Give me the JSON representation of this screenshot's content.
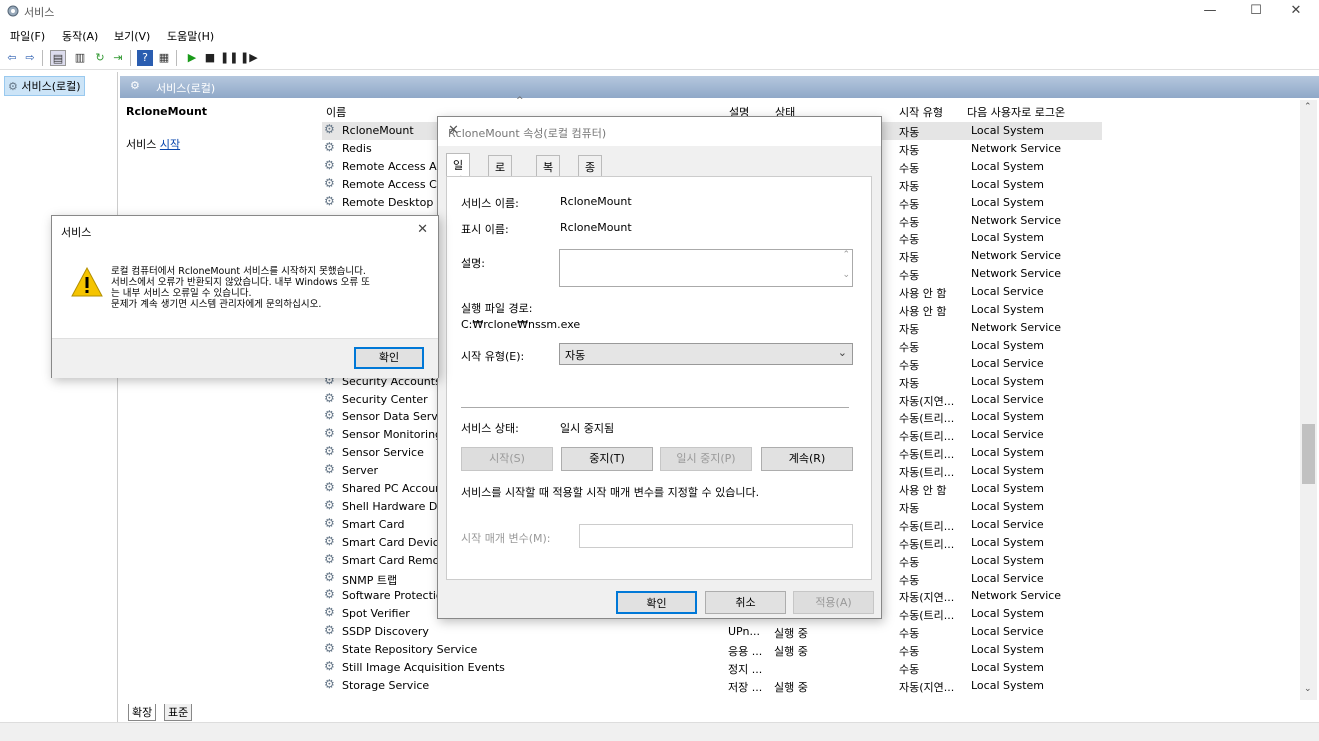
{
  "window": {
    "title": "서비스",
    "minimize": "—",
    "maximize": "☐",
    "close": "✕"
  },
  "menu": [
    "파일(F)",
    "동작(A)",
    "보기(V)",
    "도움말(H)"
  ],
  "tree": {
    "root": "서비스(로컬)"
  },
  "header": {
    "title": "서비스(로컬)"
  },
  "desc": {
    "service_name": "RcloneMount",
    "start_prefix": "서비스 ",
    "start_link": "시작"
  },
  "columns": {
    "name": "이름",
    "desc": "설명",
    "status": "상태",
    "startup": "시작 유형",
    "logon": "다음 사용자로 로그온"
  },
  "rows": [
    {
      "name": "RcloneMount",
      "desc": "",
      "status": "",
      "startup": "자동",
      "logon": "Local System"
    },
    {
      "name": "Redis",
      "desc": "",
      "status": "",
      "startup": "자동",
      "logon": "Network Service"
    },
    {
      "name": "Remote Access Aut",
      "desc": "",
      "status": "",
      "startup": "수동",
      "logon": "Local System"
    },
    {
      "name": "Remote Access Cor",
      "desc": "",
      "status": "",
      "startup": "자동",
      "logon": "Local System"
    },
    {
      "name": "Remote Desktop C",
      "desc": "",
      "status": "",
      "startup": "수동",
      "logon": "Local System"
    },
    {
      "name": "",
      "desc": "",
      "status": "",
      "startup": "수동",
      "logon": "Network Service"
    },
    {
      "name": "",
      "desc": "",
      "status": "",
      "startup": "수동",
      "logon": "Local System"
    },
    {
      "name": "",
      "desc": "",
      "status": "",
      "startup": "자동",
      "logon": "Network Service"
    },
    {
      "name": "",
      "desc": "",
      "status": "",
      "startup": "수동",
      "logon": "Network Service"
    },
    {
      "name": "",
      "desc": "",
      "status": "",
      "startup": "사용 안 함",
      "logon": "Local Service"
    },
    {
      "name": "",
      "desc": "",
      "status": "",
      "startup": "사용 안 함",
      "logon": "Local System"
    },
    {
      "name": "",
      "desc": "",
      "status": "",
      "startup": "자동",
      "logon": "Network Service"
    },
    {
      "name": "",
      "desc": "",
      "status": "",
      "startup": "수동",
      "logon": "Local System"
    },
    {
      "name": "",
      "desc": "",
      "status": "",
      "startup": "수동",
      "logon": "Local Service"
    },
    {
      "name": "Security Accounts I",
      "desc": "",
      "status": "",
      "startup": "자동",
      "logon": "Local System"
    },
    {
      "name": "Security Center",
      "desc": "",
      "status": "",
      "startup": "자동(지연...",
      "logon": "Local Service"
    },
    {
      "name": "Sensor Data Servic",
      "desc": "",
      "status": "",
      "startup": "수동(트리...",
      "logon": "Local System"
    },
    {
      "name": "Sensor Monitoring",
      "desc": "",
      "status": "",
      "startup": "수동(트리...",
      "logon": "Local Service"
    },
    {
      "name": "Sensor Service",
      "desc": "",
      "status": "",
      "startup": "수동(트리...",
      "logon": "Local System"
    },
    {
      "name": "Server",
      "desc": "",
      "status": "",
      "startup": "자동(트리...",
      "logon": "Local System"
    },
    {
      "name": "Shared PC Account",
      "desc": "",
      "status": "",
      "startup": "사용 안 함",
      "logon": "Local System"
    },
    {
      "name": "Shell Hardware Det",
      "desc": "",
      "status": "",
      "startup": "자동",
      "logon": "Local System"
    },
    {
      "name": "Smart Card",
      "desc": "",
      "status": "",
      "startup": "수동(트리...",
      "logon": "Local Service"
    },
    {
      "name": "Smart Card Device",
      "desc": "",
      "status": "",
      "startup": "수동(트리...",
      "logon": "Local System"
    },
    {
      "name": "Smart Card Remov",
      "desc": "",
      "status": "",
      "startup": "수동",
      "logon": "Local System"
    },
    {
      "name": "SNMP 트랩",
      "desc": "",
      "status": "",
      "startup": "수동",
      "logon": "Local Service"
    },
    {
      "name": "Software Protection",
      "desc": "",
      "status": "",
      "startup": "자동(지연...",
      "logon": "Network Service"
    },
    {
      "name": "Spot Verifier",
      "desc": "",
      "status": "",
      "startup": "수동(트리...",
      "logon": "Local System"
    },
    {
      "name": "SSDP Discovery",
      "desc": "UPn...",
      "status": "실행 중",
      "startup": "수동",
      "logon": "Local Service"
    },
    {
      "name": "State Repository Service",
      "desc": "응용 ...",
      "status": "실행 중",
      "startup": "수동",
      "logon": "Local System"
    },
    {
      "name": "Still Image Acquisition Events",
      "desc": "정지 ...",
      "status": "",
      "startup": "수동",
      "logon": "Local System"
    },
    {
      "name": "Storage Service",
      "desc": "저장 ...",
      "status": "실행 중",
      "startup": "자동(지연...",
      "logon": "Local System"
    }
  ],
  "bottom_tabs": [
    "확장",
    "표준"
  ],
  "props": {
    "title": "RcloneMount 속성(로컬 컴퓨터)",
    "tabs": [
      "일반",
      "로그온",
      "복구",
      "종속성"
    ],
    "svc_name_label": "서비스 이름:",
    "svc_name": "RcloneMount",
    "display_label": "표시 이름:",
    "display": "RcloneMount",
    "desc_label": "설명:",
    "path_label": "실행 파일 경로:",
    "path": "C:₩rclone₩nssm.exe",
    "startup_label": "시작 유형(E):",
    "startup": "자동",
    "status_label": "서비스 상태:",
    "status": "일시 중지됨",
    "btn_start": "시작(S)",
    "btn_stop": "중지(T)",
    "btn_pause": "일시 중지(P)",
    "btn_resume": "계속(R)",
    "hint": "서비스를 시작할 때 적용할 시작 매개 변수를 지정할 수 있습니다.",
    "params_label": "시작 매개 변수(M):",
    "ok": "확인",
    "cancel": "취소",
    "apply": "적용(A)"
  },
  "error": {
    "title": "서비스",
    "lines": [
      "로컬 컴퓨터에서 RcloneMount 서비스를 시작하지 못했습니다.",
      "서비스에서 오류가 반환되지 않았습니다. 내부 Windows 오류 또",
      "는 내부 서비스 오류일 수 있습니다.",
      "문제가 계속 생기면 시스템 관리자에게 문의하십시오."
    ],
    "ok": "확인"
  },
  "colors": {
    "selection": "#e5e5e5",
    "header_bar": "#8fa8c8",
    "warning": "#f5c400",
    "accent": "#0078d7"
  }
}
